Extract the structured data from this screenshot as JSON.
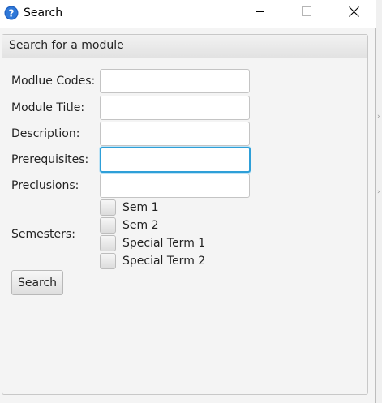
{
  "window": {
    "title": "Search",
    "app_icon": "question-icon",
    "controls": {
      "minimize_icon": "minimize-icon",
      "maximize_icon": "maximize-icon",
      "close_icon": "close-icon"
    }
  },
  "panel": {
    "title": "Search for a module"
  },
  "form": {
    "fields": [
      {
        "label": "Modlue Codes:",
        "value": ""
      },
      {
        "label": "Module Title:",
        "value": ""
      },
      {
        "label": "Description:",
        "value": ""
      },
      {
        "label": "Prerequisites:",
        "value": ""
      },
      {
        "label": "Preclusions:",
        "value": ""
      }
    ],
    "semesters_label": "Semesters:",
    "semesters": [
      {
        "label": "Sem 1",
        "checked": false
      },
      {
        "label": "Sem 2",
        "checked": false
      },
      {
        "label": "Special Term 1",
        "checked": false
      },
      {
        "label": "Special Term 2",
        "checked": false
      }
    ],
    "search_button": "Search"
  },
  "colors": {
    "focus_ring": "#2e9fd8",
    "help_icon_blue": "#1e5fbf"
  }
}
